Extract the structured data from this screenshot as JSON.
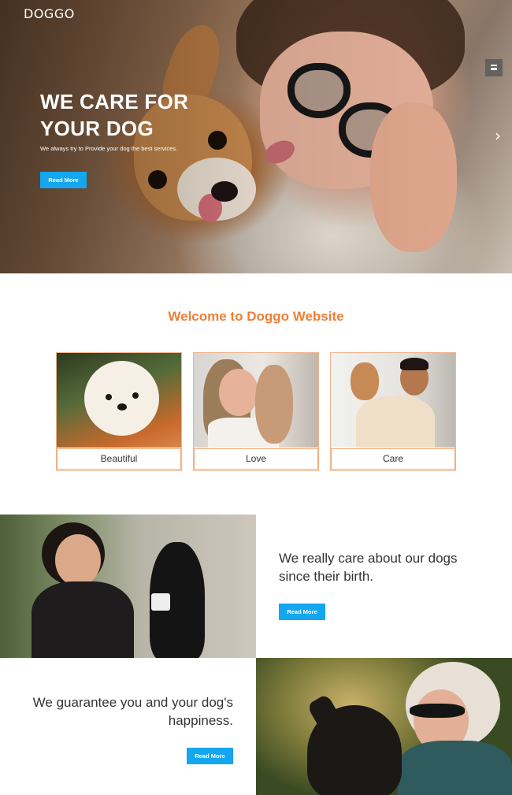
{
  "brand": "DOGGO",
  "hero": {
    "title": "WE CARE FOR YOUR DOG",
    "subtitle": "We always try to Provide your dog the best services.",
    "button": "Read More",
    "menu_icon": "hamburger-icon",
    "next_icon": "chevron-right-icon"
  },
  "welcome": {
    "title": "Welcome to Doggo Website",
    "cards": [
      {
        "label": "Beautiful"
      },
      {
        "label": "Love"
      },
      {
        "label": "Care"
      }
    ]
  },
  "features": [
    {
      "text": "We really care about our dogs since their birth.",
      "button": "Read More"
    },
    {
      "text": "We guarantee you and your dog's happiness.",
      "button": "Read More"
    }
  ],
  "colors": {
    "accent": "#ef7e34",
    "button": "#14a6ef",
    "card_border": "#f0b48c"
  }
}
